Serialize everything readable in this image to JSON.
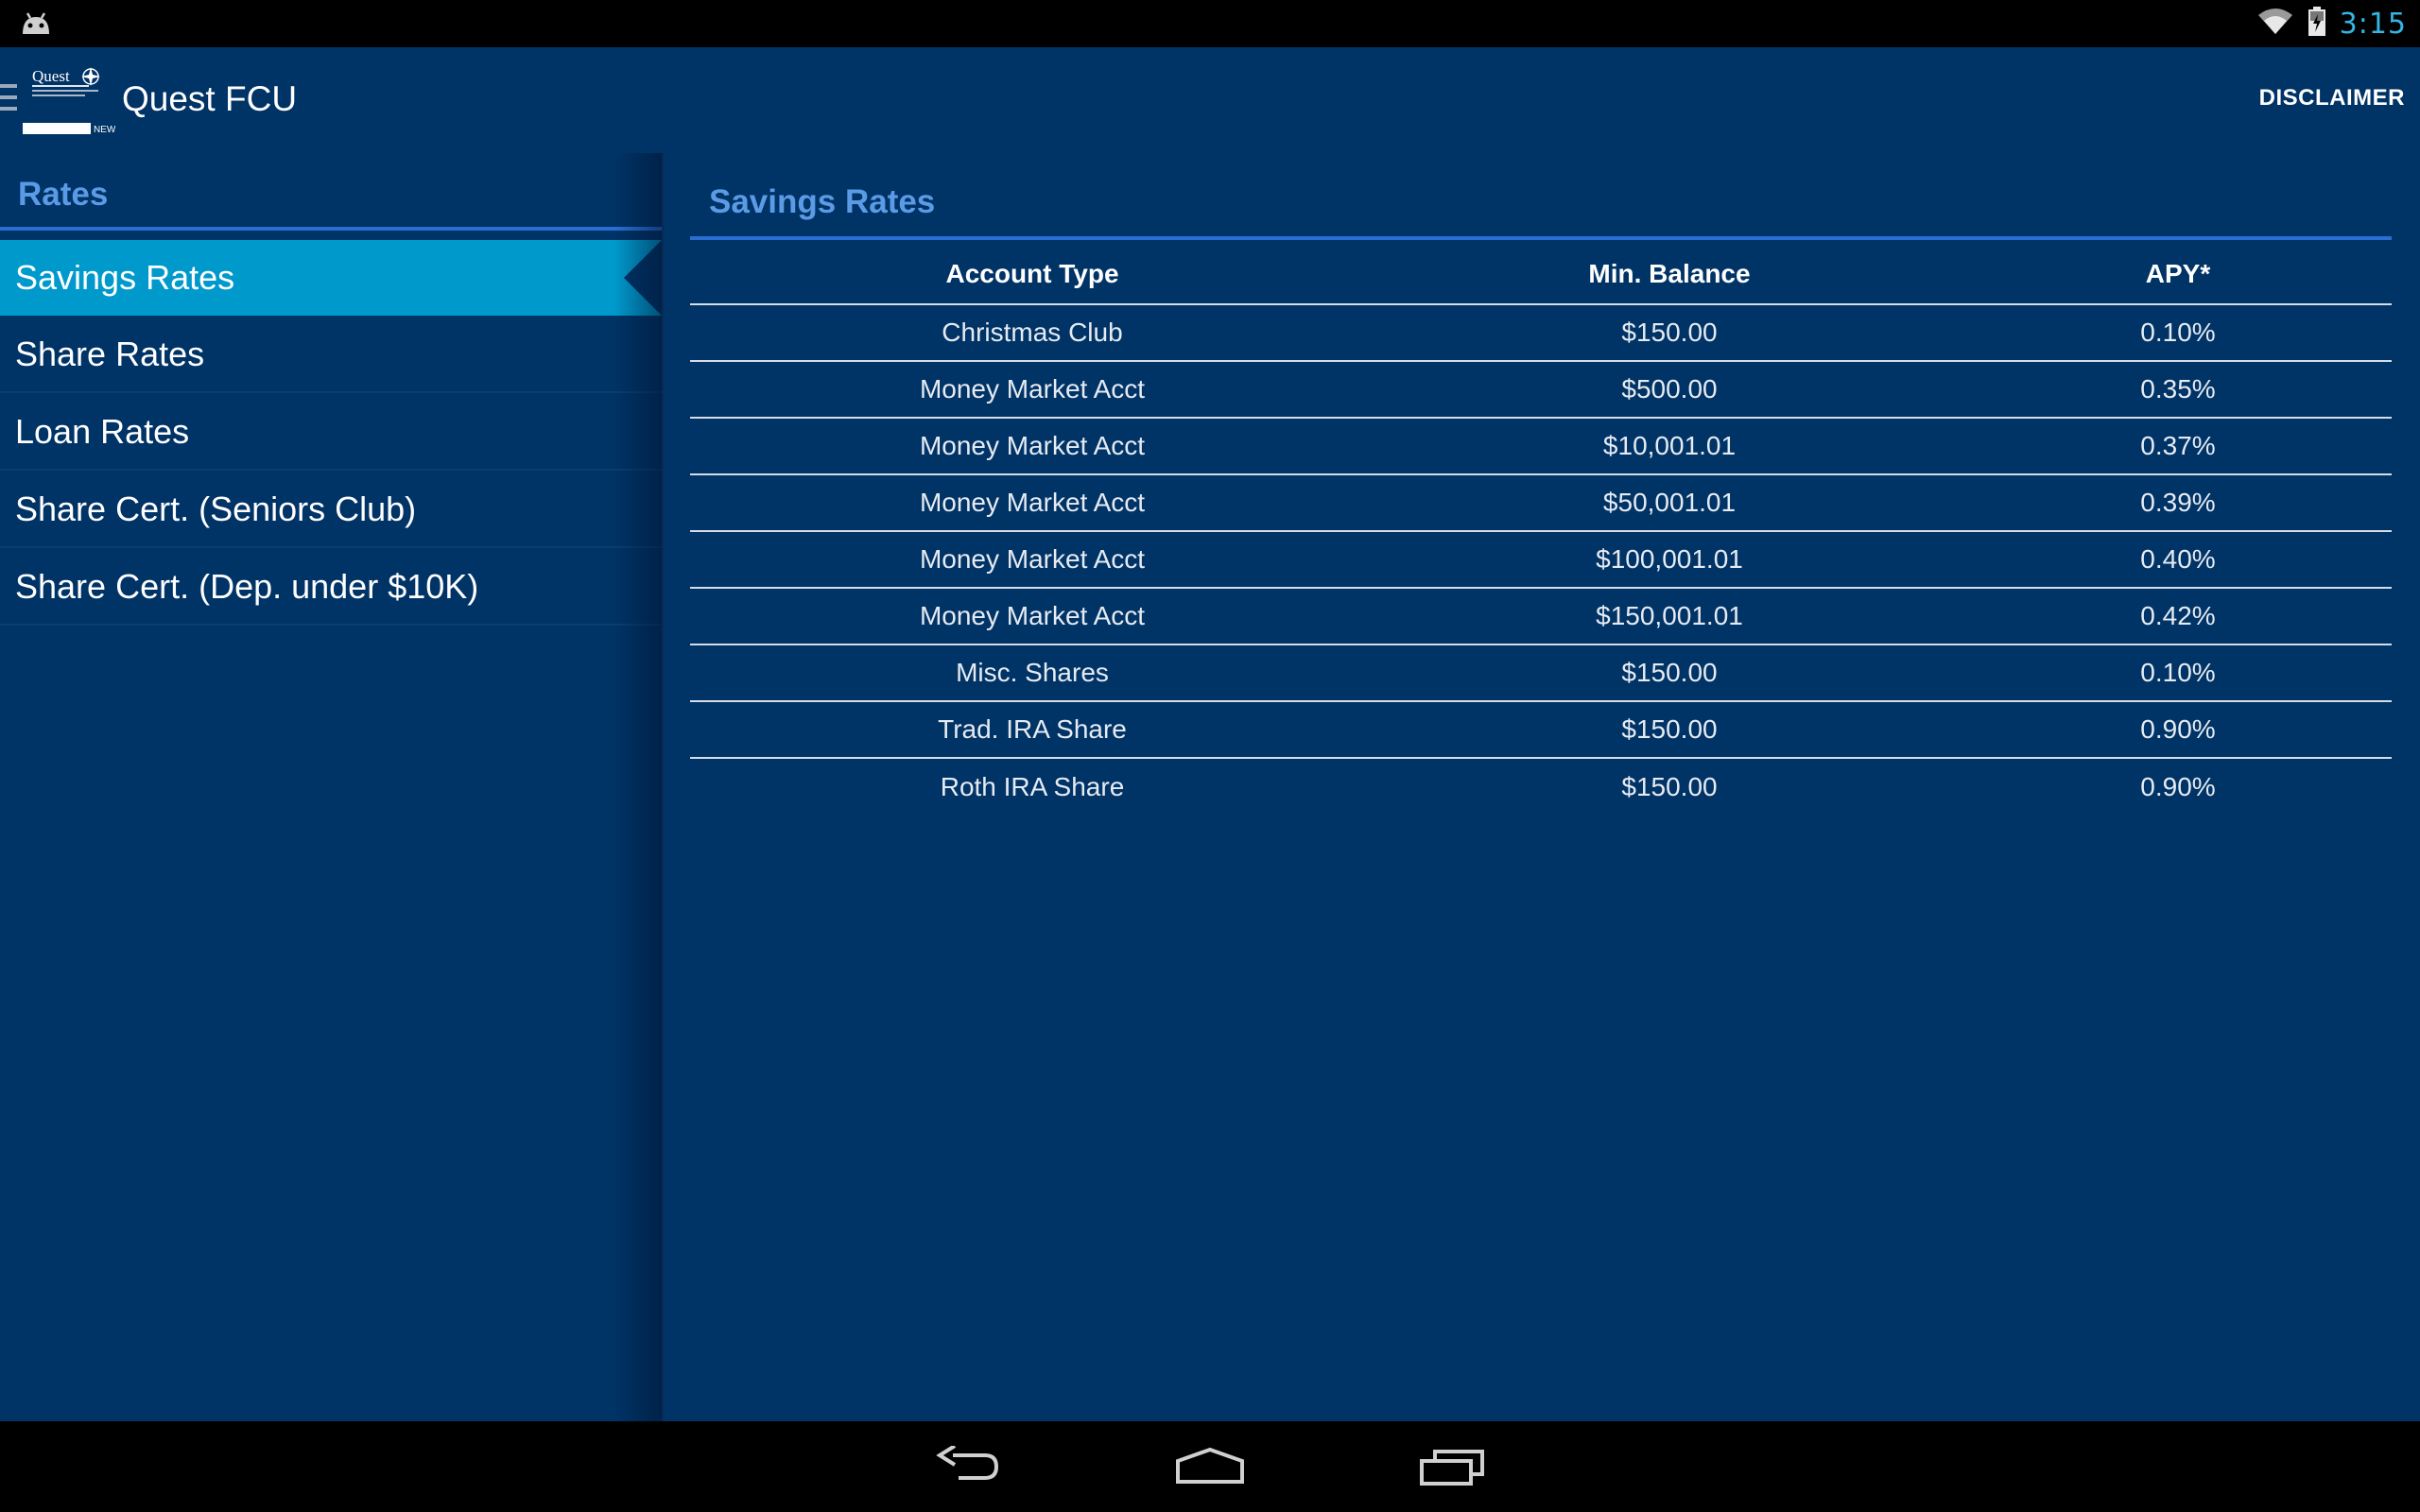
{
  "status_bar": {
    "time": "3:15",
    "icons": [
      "android-debug-icon",
      "wifi-icon",
      "battery-charging-icon"
    ]
  },
  "app_bar": {
    "title": "Quest FCU",
    "logo_text": "Quest",
    "logo_subtext": "Federal Credit Union",
    "logo_badge": "NEW",
    "action": "DISCLAIMER"
  },
  "sidebar": {
    "header": "Rates",
    "items": [
      {
        "label": "Savings Rates",
        "active": true
      },
      {
        "label": "Share Rates",
        "active": false
      },
      {
        "label": "Loan Rates",
        "active": false
      },
      {
        "label": "Share Cert. (Seniors Club)",
        "active": false
      },
      {
        "label": "Share Cert. (Dep. under $10K)",
        "active": false
      }
    ]
  },
  "content": {
    "title": "Savings Rates",
    "columns": [
      "Account Type",
      "Min. Balance",
      "APY*"
    ],
    "rows": [
      [
        "Christmas Club",
        "$150.00",
        "0.10%"
      ],
      [
        "Money Market Acct",
        "$500.00",
        "0.35%"
      ],
      [
        "Money Market Acct",
        "$10,001.01",
        "0.37%"
      ],
      [
        "Money Market Acct",
        "$50,001.01",
        "0.39%"
      ],
      [
        "Money Market Acct",
        "$100,001.01",
        "0.40%"
      ],
      [
        "Money Market Acct",
        "$150,001.01",
        "0.42%"
      ],
      [
        "Misc. Shares",
        "$150.00",
        "0.10%"
      ],
      [
        "Trad. IRA Share",
        "$150.00",
        "0.90%"
      ],
      [
        "Roth IRA Share",
        "$150.00",
        "0.90%"
      ]
    ]
  },
  "nav_bar": {
    "icons": [
      "back-icon",
      "home-icon",
      "recent-apps-icon"
    ]
  },
  "colors": {
    "background": "#003366",
    "accent": "#0099cc",
    "header_text": "#5b9be6",
    "clock": "#33b5e5"
  }
}
